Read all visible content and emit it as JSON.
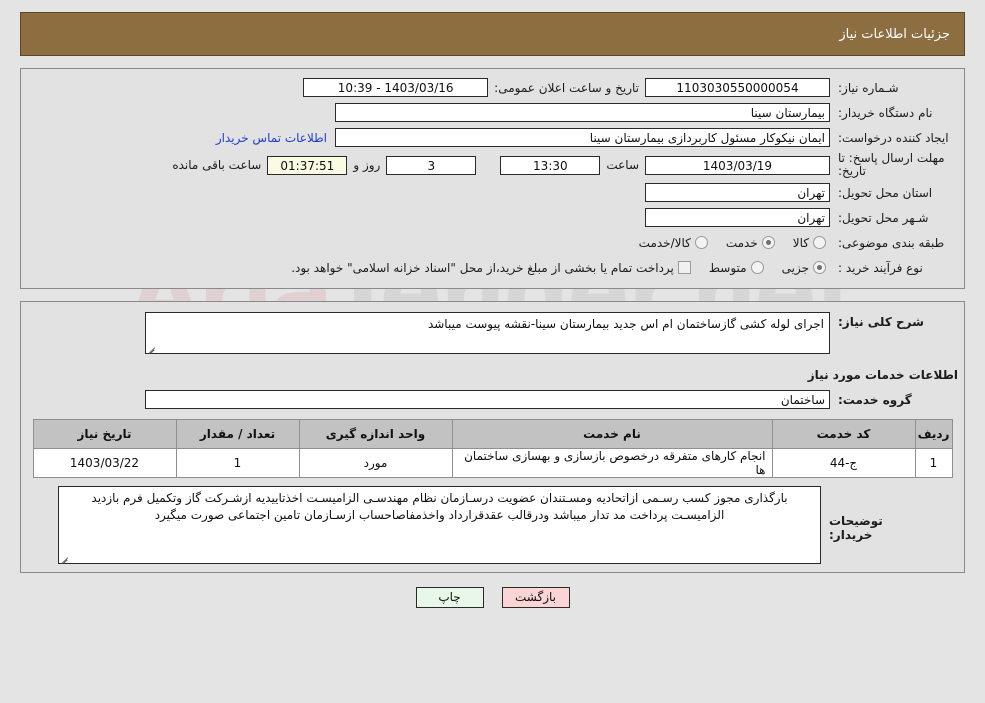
{
  "header": {
    "title": "جزئیات اطلاعات نیاز"
  },
  "watermark": {
    "text_a": "Aria",
    "text_b": "Tender",
    "text_c": ".net"
  },
  "form": {
    "need_number_label": "شـماره نیاز:",
    "need_number_value": "1103030550000054",
    "public_announce_label": "تاریخ و ساعت اعلان عمومی:",
    "public_announce_value": "1403/03/16 - 10:39",
    "buyer_org_label": "نام دستگاه خریدار:",
    "buyer_org_value": "بیمارستان سینا",
    "requester_label": "ایجاد کننده درخواست:",
    "requester_value": "ایمان نیکوکار مسئول کاربردازی  بیمارستان سینا",
    "contact_link": "اطلاعات تماس خریدار",
    "deadline_label": "مهلت ارسال پاسخ: تا تاریخ:",
    "deadline_date": "1403/03/19",
    "deadline_time_label": "ساعت",
    "deadline_time": "13:30",
    "days_left": "3",
    "days_left_label": "روز و",
    "countdown": "01:37:51",
    "countdown_label": "ساعت باقی مانده",
    "province_label": "استان محل تحویل:",
    "province_value": "تهران",
    "city_label": "شـهر محل تحویل:",
    "city_value": "تهران",
    "classification_label": "طبقه بندی موضوعی:",
    "classification_options": [
      {
        "label": "کالا",
        "selected": false
      },
      {
        "label": "خدمت",
        "selected": true
      },
      {
        "label": "کالا/خدمت",
        "selected": false
      }
    ],
    "purchase_type_label": "نوع فرآیند خرید :",
    "purchase_type_options": [
      {
        "label": "جزیی",
        "selected": true
      },
      {
        "label": "متوسط",
        "selected": false
      }
    ],
    "treasury_checkbox_checked": false,
    "treasury_note": "پرداخت تمام یا بخشی از مبلغ خرید،از محل \"اسناد خزانه اسلامی\" خواهد بود."
  },
  "details": {
    "need_summary_label": "شرح کلی نیاز:",
    "need_summary_value": "اجرای لوله کشی گازساختمان ام اس جدید بیمارستان سینا-نقشه پیوست میباشد",
    "services_heading": "اطلاعات خدمات مورد نیاز",
    "service_group_label": "گروه خدمت:",
    "service_group_value": "ساختمان",
    "table": {
      "columns": [
        "ردیف",
        "کد خدمت",
        "نام خدمت",
        "واحد اندازه گیری",
        "تعداد / مقدار",
        "تاریخ نیاز"
      ],
      "rows": [
        {
          "radif": "1",
          "code": "ج-44",
          "name": "انجام کارهای متفرقه درخصوص بازسازی و بهسازی ساختمان ها",
          "unit": "مورد",
          "qty": "1",
          "date": "1403/03/22"
        }
      ]
    },
    "buyer_notes_label": "توضیحات خریدار:",
    "buyer_notes_value": "بارگذاری مجوز کسب رسـمی ازاتحادیه ومسـتندان عضویت درسـازمان نظام مهندسـی الزامیسـت اخذتاییدیه ازشـرکت گاز وتکمیل فرم بازدید الزامیسـت پرداخت مد تدار میباشد ودرقالب عقدقرارداد واخذمفاصاحساب ازسـازمان تامین اجتماعی صورت میگیرد"
  },
  "footer": {
    "print_label": "چاپ",
    "back_label": "بازگشت"
  }
}
